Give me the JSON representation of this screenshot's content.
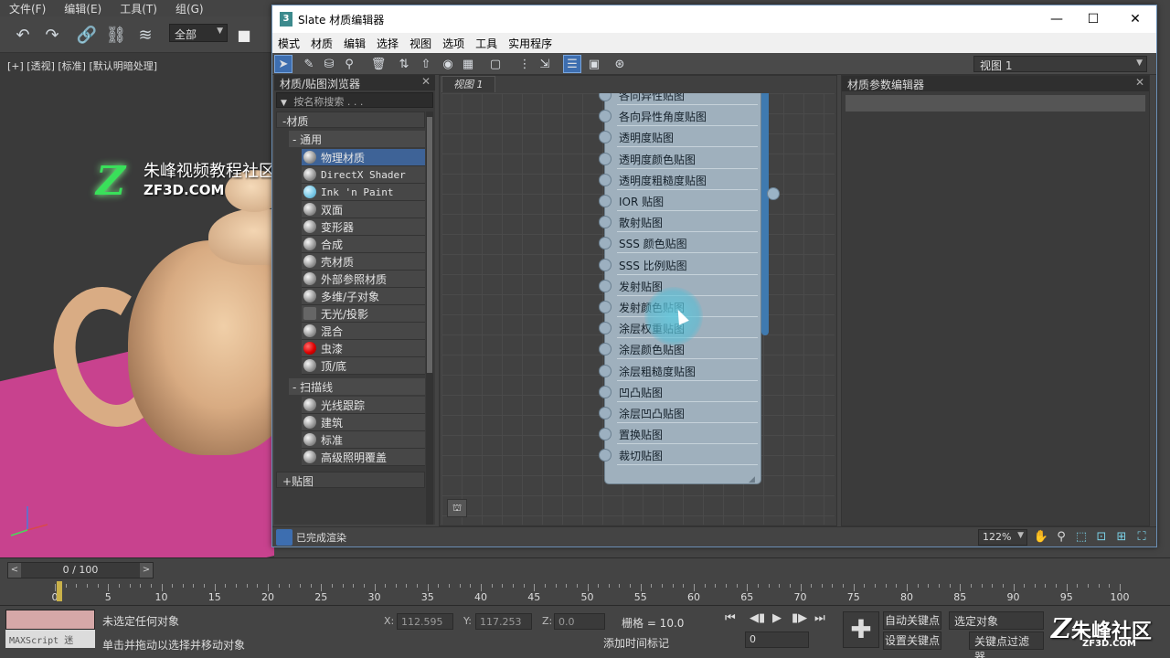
{
  "max": {
    "menu": [
      "文件(F)",
      "编辑(E)",
      "工具(T)",
      "组(G)"
    ],
    "selection_filter": "全部",
    "viewport_label": "[+] [透视] [标准] [默认明暗处理]",
    "watermark": {
      "logo": "Z",
      "title": "朱峰视频教程社区",
      "sub": "ZF3D.COM"
    }
  },
  "slate": {
    "title": "Slate 材质编辑器",
    "app_icon": "3",
    "window_controls": {
      "minimize": "—",
      "maximize": "☐",
      "close": "✕"
    },
    "menu": [
      "模式",
      "材质",
      "编辑",
      "选择",
      "视图",
      "选项",
      "工具",
      "实用程序"
    ],
    "view_dropdown": "视图 1",
    "browser": {
      "title": "材质/贴图浏览器",
      "search_placeholder": "按名称搜索 . . .",
      "root_category": "-材质",
      "groups": [
        {
          "label": "- 通用",
          "items": [
            {
              "label": "物理材质",
              "ball": "gray",
              "selected": true
            },
            {
              "label": "DirectX Shader",
              "ball": "gray",
              "mono": true
            },
            {
              "label": "Ink 'n Paint",
              "ball": "cyan",
              "mono": true
            },
            {
              "label": "双面",
              "ball": "gray"
            },
            {
              "label": "变形器",
              "ball": "gray"
            },
            {
              "label": "合成",
              "ball": "gray"
            },
            {
              "label": "壳材质",
              "ball": "gray"
            },
            {
              "label": "外部参照材质",
              "ball": "gray"
            },
            {
              "label": "多维/子对象",
              "ball": "gray"
            },
            {
              "label": "无光/投影",
              "ball": "flat"
            },
            {
              "label": "混合",
              "ball": "gray"
            },
            {
              "label": "虫漆",
              "ball": "red"
            },
            {
              "label": "顶/底",
              "ball": "gray"
            }
          ]
        },
        {
          "label": "- 扫描线",
          "items": [
            {
              "label": "光线跟踪",
              "ball": "gray"
            },
            {
              "label": "建筑",
              "ball": "gray"
            },
            {
              "label": "标准",
              "ball": "gray"
            },
            {
              "label": "高级照明覆盖",
              "ball": "gray"
            }
          ]
        }
      ],
      "maps_category": "+贴图"
    },
    "view_tab": "视图 1",
    "node_slots": [
      "各向异性贴图",
      "各向异性角度贴图",
      "透明度贴图",
      "透明度颜色贴图",
      "透明度粗糙度贴图",
      "IOR 贴图",
      "散射贴图",
      "SSS 颜色贴图",
      "SSS 比例贴图",
      "发射贴图",
      "发射颜色贴图",
      "涂层权重贴图",
      "涂层颜色贴图",
      "涂层粗糙度贴图",
      "凹凸贴图",
      "涂层凹凸贴图",
      "置换贴图",
      "裁切贴图"
    ],
    "params_title": "材质参数编辑器",
    "status": "已完成渲染",
    "zoom": "122%"
  },
  "timeline": {
    "frame": "0 / 100",
    "ticks": [
      "0",
      "5",
      "10",
      "15",
      "20",
      "25",
      "30",
      "35",
      "40",
      "45",
      "50",
      "55",
      "60",
      "65",
      "70",
      "75",
      "80",
      "85",
      "90",
      "95",
      "100"
    ]
  },
  "status": {
    "maxscript": "MAXScript 迷",
    "line1": "未选定任何对象",
    "line2": "单击并拖动以选择并移动对象",
    "x_label": "X:",
    "x": "112.595",
    "y_label": "Y:",
    "y": "117.253",
    "z_label": "Z:",
    "z": "0.0",
    "grid": "栅格 = 10.0",
    "add_time_tag": "添加时间标记",
    "auto_key": "自动关键点",
    "set_key": "设置关键点",
    "selected": "选定对象",
    "key_filter": "关键点过滤器...",
    "frame_value": "0",
    "logo": "朱峰社区",
    "logo_sub": "ZF3D.COM"
  }
}
